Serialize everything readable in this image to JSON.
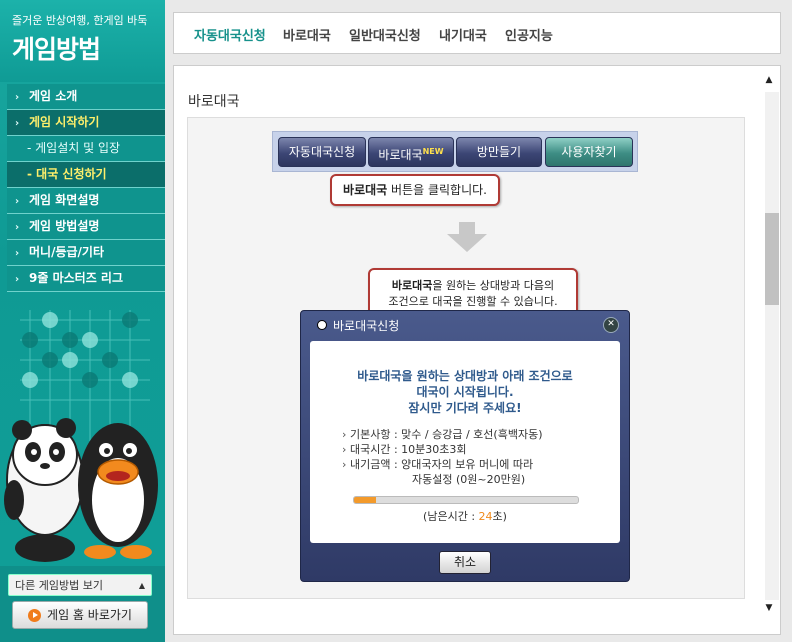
{
  "sidebar": {
    "subtitle": "즐거운 반상여행, 한게임 바둑",
    "title": "게임방법",
    "menu": [
      {
        "label": "게임 소개"
      },
      {
        "label": "게임 시작하기"
      },
      {
        "label": "- 게임설치 및 입장"
      },
      {
        "label": "- 대국 신청하기"
      },
      {
        "label": "게임 화면설명"
      },
      {
        "label": "게임 방법설명"
      },
      {
        "label": "머니/등급/기타"
      },
      {
        "label": "9줄 마스터즈 리그"
      }
    ],
    "other_select": "다른 게임방법 보기",
    "home_button": "게임 홈 바로가기"
  },
  "tabs": [
    "자동대국신청",
    "바로대국",
    "일반대국신청",
    "내기대국",
    "인공지능"
  ],
  "active_tab": "자동대국신청",
  "section_title": "바로대국",
  "demo": {
    "buttons": [
      "자동대국신청",
      "바로대국",
      "방만들기",
      "사용자찾기"
    ],
    "new_badge": "NEW",
    "callout1_bold": "바로대국",
    "callout1_rest": " 버튼을 클릭합니다.",
    "callout2_bold": "바로대국",
    "callout2_line1_rest": "을 원하는 상대방과 다음의",
    "callout2_line2": "조건으로 대국을 진행할 수 있습니다.",
    "dialog": {
      "title": "바로대국신청",
      "message_lines": [
        "바로대국을 원하는 상대방과 아래 조건으로",
        "대국이 시작됩니다.",
        "잠시만 기다려 주세요!"
      ],
      "info": [
        "기본사항 : 맞수 / 승강급 / 호선(흑백자동)",
        "대국시간 : 10분30초3회",
        "내기금액 : 양대국자의 보유 머니에 따라"
      ],
      "info_cont": "자동설정 (0원~20만원)",
      "progress": 0.1,
      "remain_prefix": "(남은시간 : ",
      "remain_value": "24",
      "remain_suffix": "초)",
      "cancel": "취소"
    }
  }
}
